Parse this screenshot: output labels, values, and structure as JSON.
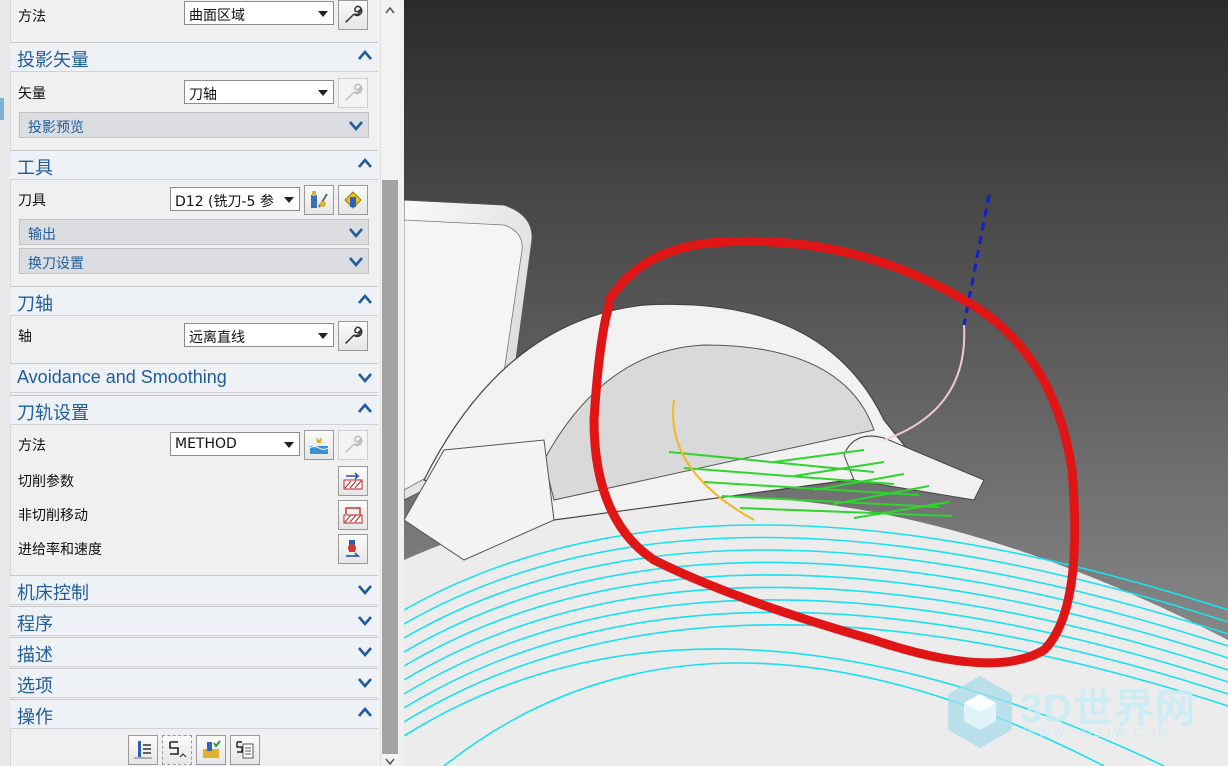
{
  "panel": {
    "method_row": {
      "label": "方法",
      "value": "曲面区域"
    },
    "projection_vector": {
      "title": "投影矢量",
      "vector_label": "矢量",
      "vector_value": "刀轴",
      "preview": "投影预览"
    },
    "tool": {
      "title": "工具",
      "tool_label": "刀具",
      "tool_value": "D12 (铣刀-5 参",
      "output": "输出",
      "tool_change": "换刀设置"
    },
    "tool_axis": {
      "title": "刀轴",
      "axis_label": "轴",
      "axis_value": "远离直线"
    },
    "avoidance": {
      "title": "Avoidance and Smoothing"
    },
    "path_settings": {
      "title": "刀轨设置",
      "method_label": "方法",
      "method_value": "METHOD",
      "cut_params": "切削参数",
      "non_cut_moves": "非切削移动",
      "feeds_speeds": "进给率和速度"
    },
    "machine_control": {
      "title": "机床控制"
    },
    "program": {
      "title": "程序"
    },
    "description": {
      "title": "描述"
    },
    "options": {
      "title": "选项"
    },
    "actions": {
      "title": "操作"
    }
  },
  "watermark": {
    "brand": "3D世界网",
    "url": "WWW.3DSJW.COM"
  },
  "colors": {
    "section_title": "#1f5d9c",
    "toolpath": "#19e1f0",
    "annotation": "#e01616",
    "grid_lines": "#2fd42f",
    "axis_line": "#1020d0"
  },
  "icons": [
    "wrench-icon",
    "chevron-up-icon",
    "chevron-down-icon",
    "edit-tool-icon",
    "new-tool-icon",
    "method-edit-icon",
    "cut-params-icon",
    "non-cut-moves-icon",
    "feeds-speeds-icon",
    "generate-icon",
    "replay-icon",
    "verify-icon",
    "list-icon"
  ]
}
